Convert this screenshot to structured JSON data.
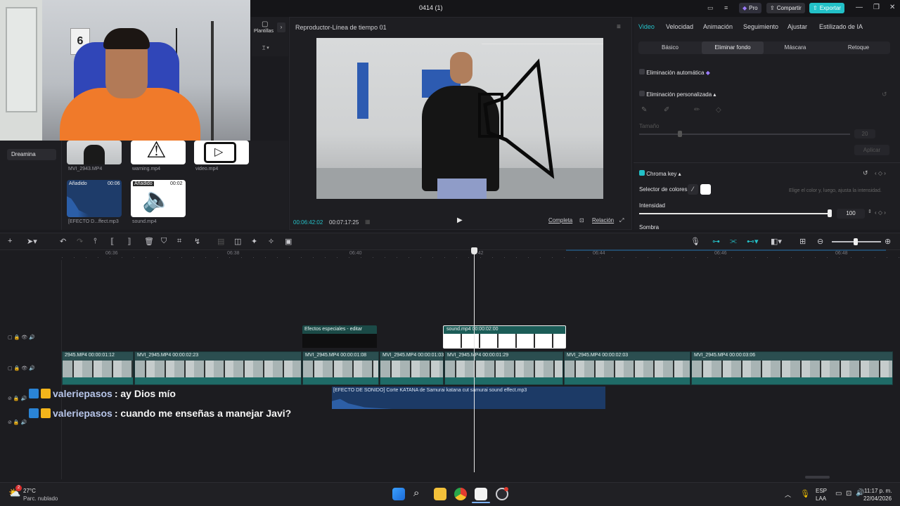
{
  "window": {
    "title": "0414 (1)",
    "pro_label": "Pro",
    "share_label": "Compartir",
    "export_label": "Exportar"
  },
  "media": {
    "templates_label": "Plantillas",
    "nav_item": "Dreamina",
    "items": [
      {
        "name": "MVI_2943.MP4"
      },
      {
        "name": "warning.mp4"
      },
      {
        "name": "video.mp4"
      },
      {
        "name": "[EFECTO D...ffect.mp3",
        "badge": "Añadido",
        "duration": "00:06"
      },
      {
        "name": "sound.mp4",
        "badge": "Añadido",
        "duration": "00:02"
      }
    ]
  },
  "player": {
    "header": "Reproductor-Línea de tiempo 01",
    "current_time": "00:06:42:02",
    "total_time": "00:07:17:25",
    "full_label": "Completa",
    "ratio_label": "Relación"
  },
  "inspector": {
    "tabs": [
      "Video",
      "Velocidad",
      "Animación",
      "Seguimiento",
      "Ajustar",
      "Estilizado de IA"
    ],
    "subtabs": [
      "Básico",
      "Eliminar fondo",
      "Máscara",
      "Retoque"
    ],
    "auto_remove": "Eliminación automática",
    "custom_remove": "Eliminación personalizada",
    "size_label": "Tamaño",
    "size_value": "20",
    "apply_label": "Aplicar",
    "chroma_label": "Chroma key",
    "color_selector": "Selector de colores",
    "color_hint": "Elige el color y, luego, ajusta la intensidad.",
    "intensity_label": "Intensidad",
    "intensity_value": "100",
    "shadow_label": "Sombra"
  },
  "timeline": {
    "ruler_ticks": [
      "06:36",
      "06:38",
      "06:40",
      "06:42",
      "06:44",
      "06:46",
      "06:48"
    ],
    "fx_clip": "Efectos especiales - editar",
    "sound_clip": "sound.mp4  00:00:02:00",
    "video_clips": [
      "2945.MP4  00:00:01:12",
      "MVI_2945.MP4  00:00:02:23",
      "MVI_2945.MP4  00:00:01:08",
      "MVI_2945.MP4  00:00:01:03",
      "MVI_2945.MP4  00:00:01:29",
      "MVI_2945.MP4  00:00:02:03",
      "MVI_2945.MP4  00:00:03:06"
    ],
    "audio_clip": "[EFECTO DE SONIDO] Corte KATANA de Samurai  katana cut samurai sound effect.mp3"
  },
  "chat": [
    {
      "user": "valeriepasos",
      "message": ": ay Dios mío"
    },
    {
      "user": "valeriepasos",
      "message": ": cuando me enseñas a manejar Javi?"
    }
  ],
  "taskbar": {
    "temp": "27°C",
    "weather": "Parc. nublado",
    "lang_top": "ESP",
    "lang_bottom": "LAA",
    "time": "11:17 p. m.",
    "date": "22/04/2026",
    "weather_badge": "2"
  },
  "colors": {
    "accent": "#25c2c9",
    "export": "#22c0c7",
    "video_clip": "#2b4e50",
    "audio_clip": "#1c3a66"
  }
}
